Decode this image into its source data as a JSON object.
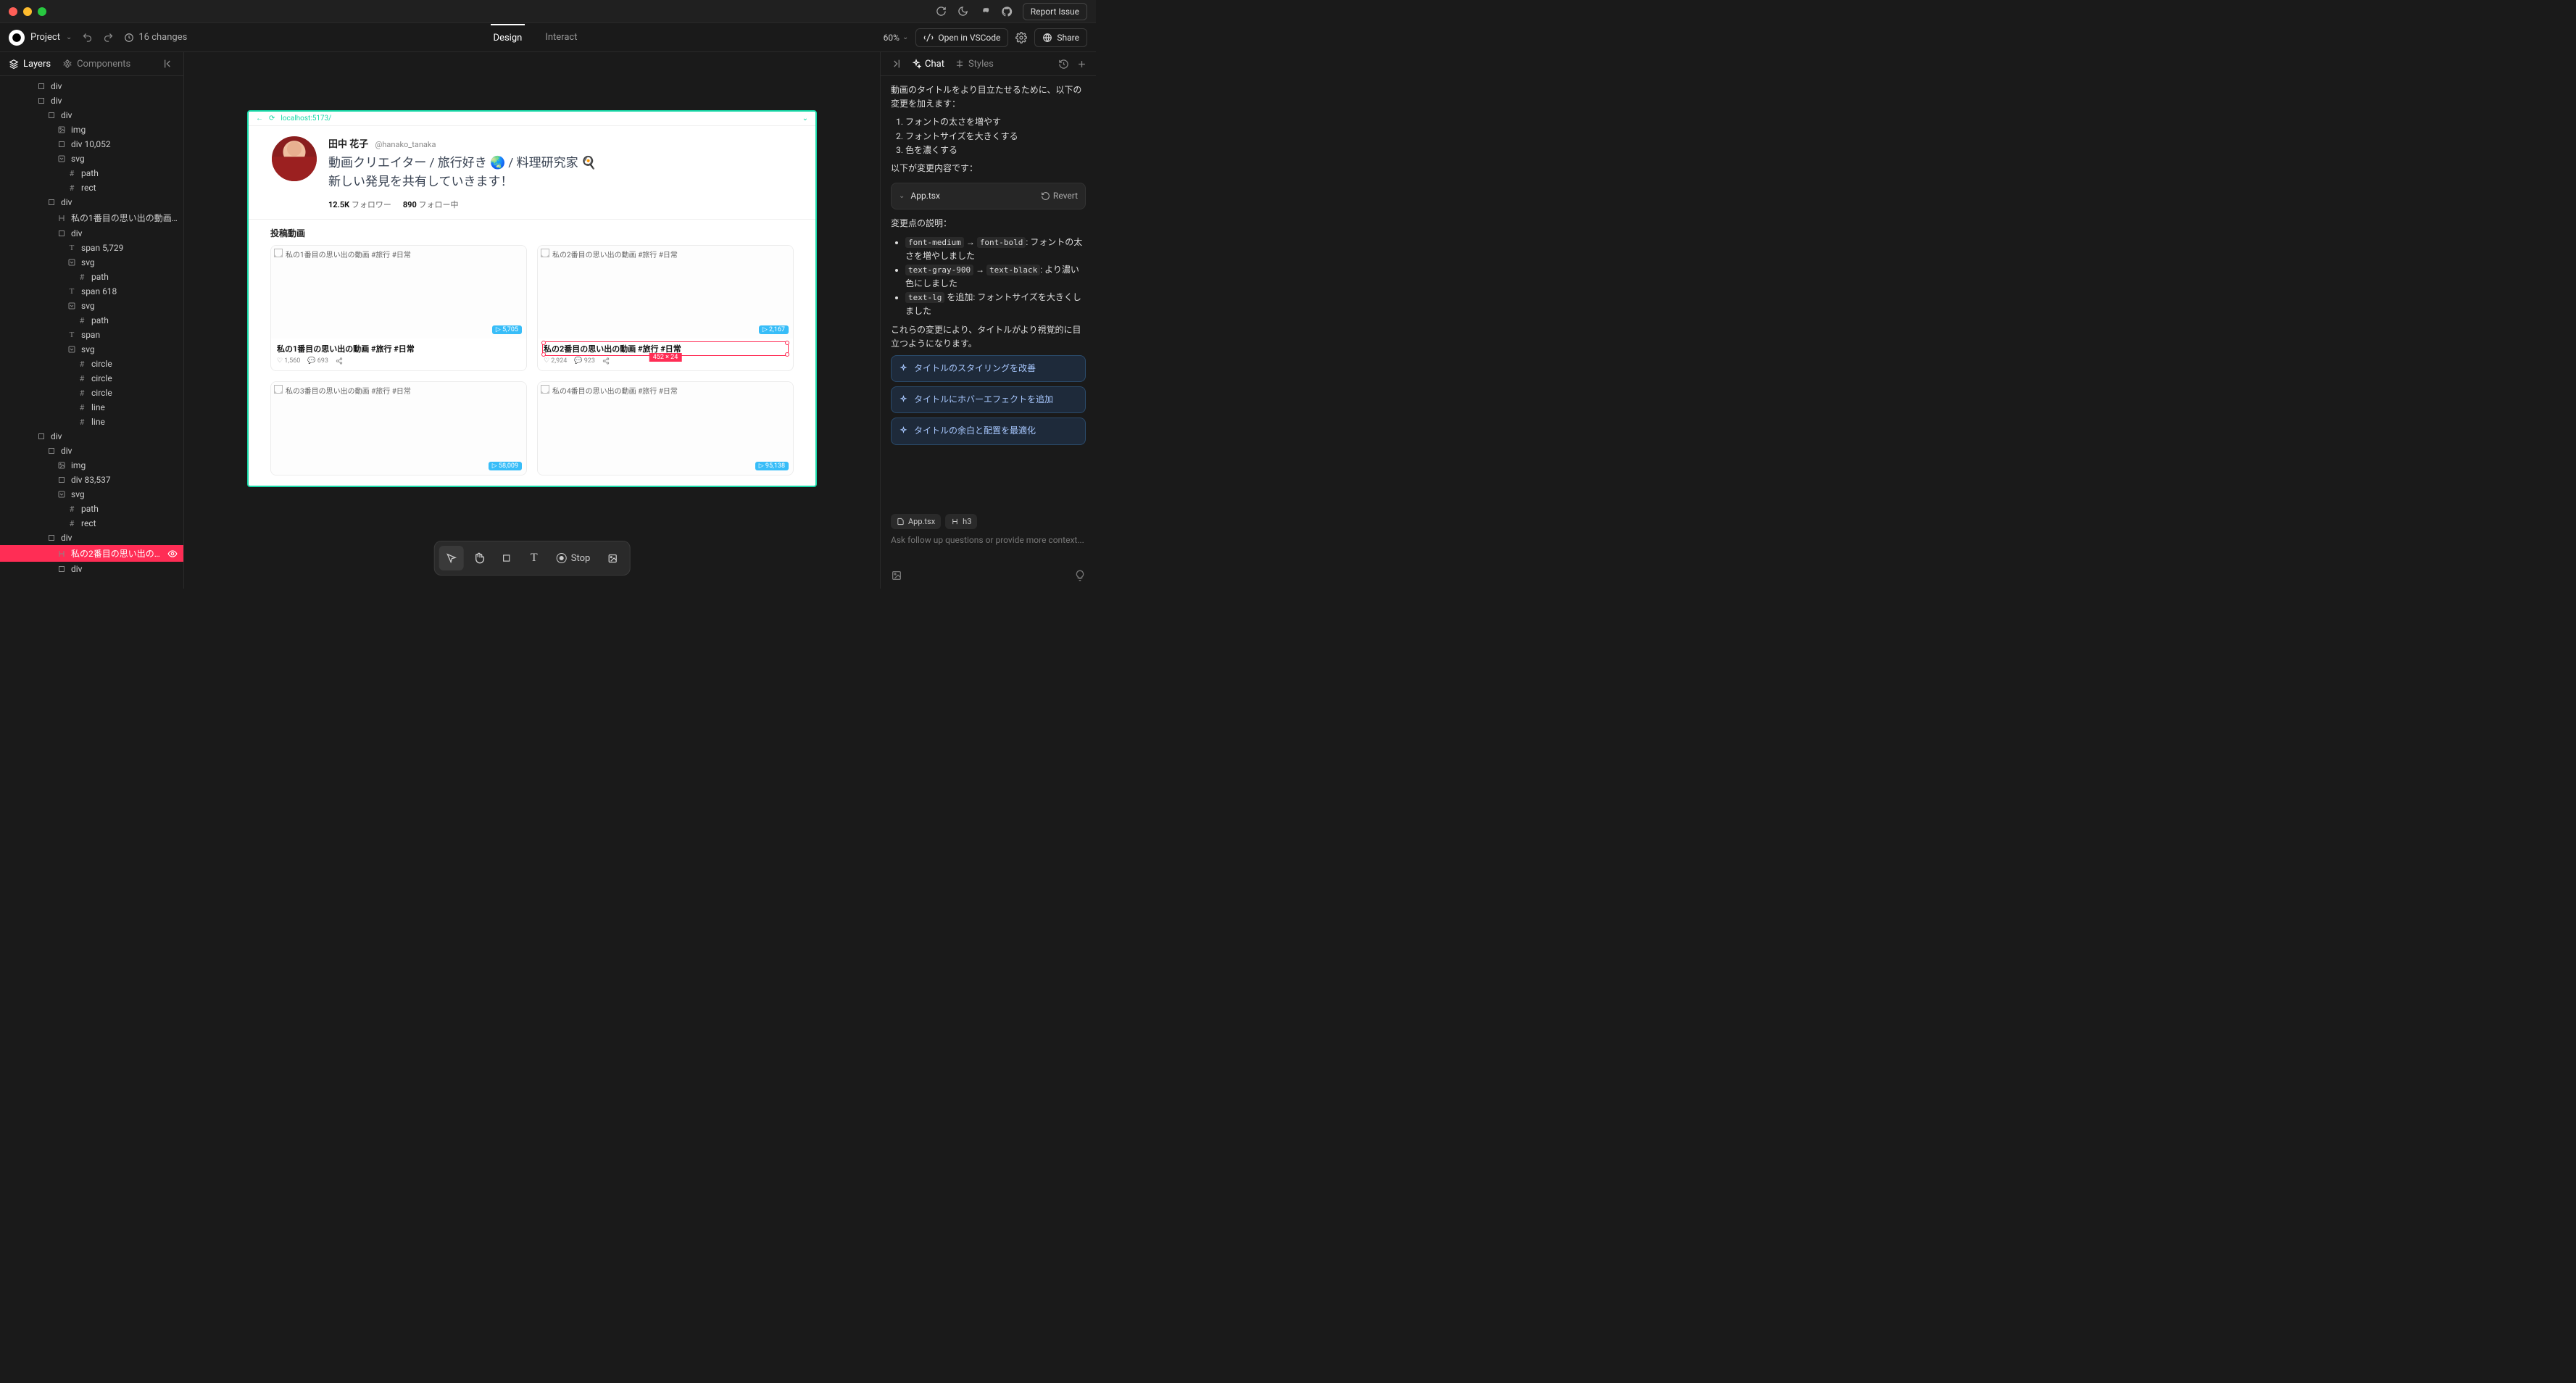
{
  "titlebar": {
    "report": "Report Issue"
  },
  "toolbar": {
    "project": "Project",
    "changes": "16 changes",
    "tabs": {
      "design": "Design",
      "interact": "Interact"
    },
    "zoom": "60%",
    "vscode": "Open in VSCode",
    "share": "Share"
  },
  "left": {
    "tabs": {
      "layers": "Layers",
      "components": "Components"
    },
    "tree": [
      {
        "indent": 3,
        "icon": "box",
        "label": "div"
      },
      {
        "indent": 3,
        "icon": "box",
        "label": "div"
      },
      {
        "indent": 4,
        "icon": "box",
        "label": "div"
      },
      {
        "indent": 5,
        "icon": "img",
        "label": "img"
      },
      {
        "indent": 5,
        "icon": "box",
        "label": "div 10,052"
      },
      {
        "indent": 5,
        "icon": "svg",
        "label": "svg"
      },
      {
        "indent": 6,
        "icon": "hash",
        "label": "path"
      },
      {
        "indent": 6,
        "icon": "hash",
        "label": "rect"
      },
      {
        "indent": 4,
        "icon": "box",
        "label": "div"
      },
      {
        "indent": 5,
        "icon": "h",
        "label": "私の1番目の思い出の動画 #旅..."
      },
      {
        "indent": 5,
        "icon": "box",
        "label": "div"
      },
      {
        "indent": 6,
        "icon": "t",
        "label": "span 5,729"
      },
      {
        "indent": 6,
        "icon": "svg",
        "label": "svg"
      },
      {
        "indent": 7,
        "icon": "hash",
        "label": "path"
      },
      {
        "indent": 6,
        "icon": "t",
        "label": "span 618"
      },
      {
        "indent": 6,
        "icon": "svg",
        "label": "svg"
      },
      {
        "indent": 7,
        "icon": "hash",
        "label": "path"
      },
      {
        "indent": 6,
        "icon": "t",
        "label": "span"
      },
      {
        "indent": 6,
        "icon": "svg",
        "label": "svg"
      },
      {
        "indent": 7,
        "icon": "hash",
        "label": "circle"
      },
      {
        "indent": 7,
        "icon": "hash",
        "label": "circle"
      },
      {
        "indent": 7,
        "icon": "hash",
        "label": "circle"
      },
      {
        "indent": 7,
        "icon": "hash",
        "label": "line"
      },
      {
        "indent": 7,
        "icon": "hash",
        "label": "line"
      },
      {
        "indent": 3,
        "icon": "box",
        "label": "div"
      },
      {
        "indent": 4,
        "icon": "box",
        "label": "div"
      },
      {
        "indent": 5,
        "icon": "img",
        "label": "img"
      },
      {
        "indent": 5,
        "icon": "box",
        "label": "div 83,537"
      },
      {
        "indent": 5,
        "icon": "svg",
        "label": "svg"
      },
      {
        "indent": 6,
        "icon": "hash",
        "label": "path"
      },
      {
        "indent": 6,
        "icon": "hash",
        "label": "rect"
      },
      {
        "indent": 4,
        "icon": "box",
        "label": "div"
      },
      {
        "indent": 5,
        "icon": "h",
        "label": "私の2番目の思い出の動画 #...",
        "sel": true
      },
      {
        "indent": 5,
        "icon": "box",
        "label": "div"
      }
    ]
  },
  "canvas": {
    "url": "localhost:5173/",
    "profile": {
      "name": "田中 花子",
      "handle": "@hanako_tanaka",
      "bio": "動画クリエイター / 旅行好き 🌏 / 料理研究家 🍳\n新しい発見を共有していきます！",
      "followers_n": "12.5K",
      "followers_l": "フォロワー",
      "following_n": "890",
      "following_l": "フォロー中"
    },
    "section": "投稿動画",
    "sel_size": "452 × 24",
    "videos": [
      {
        "alt": "私の1番目の思い出の動画 #旅行 #日常",
        "views": "5,705",
        "title": "私の1番目の思い出の動画 #旅行 #日常",
        "likes": "1,560",
        "comments": "693"
      },
      {
        "alt": "私の2番目の思い出の動画 #旅行 #日常",
        "views": "2,167",
        "title": "私の2番目の思い出の動画 #旅行 #日常",
        "likes": "2,924",
        "comments": "923",
        "sel": true
      },
      {
        "alt": "私の3番目の思い出の動画 #旅行 #日常",
        "views": "58,009"
      },
      {
        "alt": "私の4番目の思い出の動画 #旅行 #日常",
        "views": "95,138"
      }
    ]
  },
  "btool": {
    "stop": "Stop"
  },
  "right": {
    "tabs": {
      "chat": "Chat",
      "styles": "Styles"
    },
    "intro": "動画のタイトルをより目立たせるために、以下の変更を加えます：",
    "list": [
      "フォントの太さを増やす",
      "フォントサイズを大きくする",
      "色を濃くする"
    ],
    "below": "以下が変更内容です：",
    "file": "App.tsx",
    "revert": "Revert",
    "explain_h": "変更点の説明：",
    "bullets": [
      {
        "pre": "`font-medium` → `font-bold`",
        "post": ": フォントの太さを増やしました"
      },
      {
        "pre": "`text-gray-900` → `text-black`",
        "post": ": より濃い色にしました"
      },
      {
        "pre": "`text-lg` を追加",
        "post": ": フォントサイズを大きくしました"
      }
    ],
    "outro": "これらの変更により、タイトルがより視覚的に目立つようになります。",
    "suggestions": [
      "タイトルのスタイリングを改善",
      "タイトルにホバーエフェクトを追加",
      "タイトルの余白と配置を最適化"
    ],
    "ctx": [
      "App.tsx",
      "h3"
    ],
    "placeholder": "Ask follow up questions or provide more context..."
  }
}
